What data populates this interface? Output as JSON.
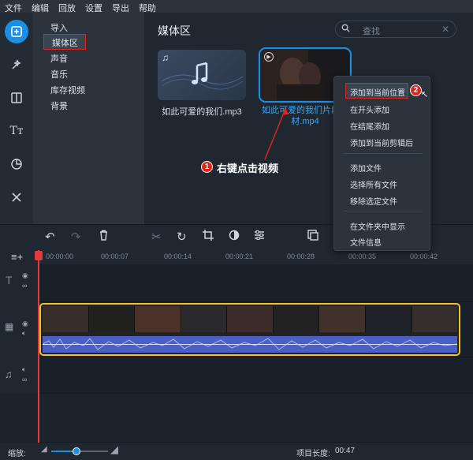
{
  "menubar": [
    "文件",
    "编辑",
    "回放",
    "设置",
    "导出",
    "帮助"
  ],
  "sidebar": {
    "items": [
      {
        "label": "导入",
        "selected": false
      },
      {
        "label": "媒体区",
        "selected": true
      },
      {
        "label": "声音",
        "selected": false
      },
      {
        "label": "音乐",
        "selected": false
      },
      {
        "label": "库存视频",
        "selected": false
      },
      {
        "label": "背景",
        "selected": false
      }
    ]
  },
  "media": {
    "title": "媒体区",
    "search_placeholder": "查找",
    "files": [
      {
        "name": "如此可爱的我们.mp3",
        "type": "audio"
      },
      {
        "name": "如此可爱的我们片段素材.mp4",
        "name_line1": "如此可爱的我们片段素",
        "name_line2": "材.mp4",
        "type": "video",
        "selected": true
      }
    ]
  },
  "context_menu": {
    "items": [
      "添加到当前位置",
      "在开头添加",
      "在结尾添加",
      "添加到当前剪辑后",
      "添加文件",
      "选择所有文件",
      "移除选定文件",
      "在文件夹中显示",
      "文件信息"
    ]
  },
  "annotations": {
    "step1_number": "1",
    "step1_text": "右键点击视频",
    "step2_number": "2"
  },
  "timeline": {
    "ruler_ticks": [
      "00:00:00",
      "00:00:07",
      "00:00:14",
      "00:00:21",
      "00:00:28",
      "00:00:35",
      "00:00:42"
    ]
  },
  "status": {
    "zoom_label": "缩放:",
    "zoom_value": 0.45,
    "length_label": "项目长度:",
    "length_value": "00:47"
  },
  "colors": {
    "accent": "#1b8fe6",
    "highlight_red": "#e0241c",
    "clip_border": "#f2c12e",
    "wave": "#4b5fc6",
    "playhead": "#e63a3a"
  }
}
